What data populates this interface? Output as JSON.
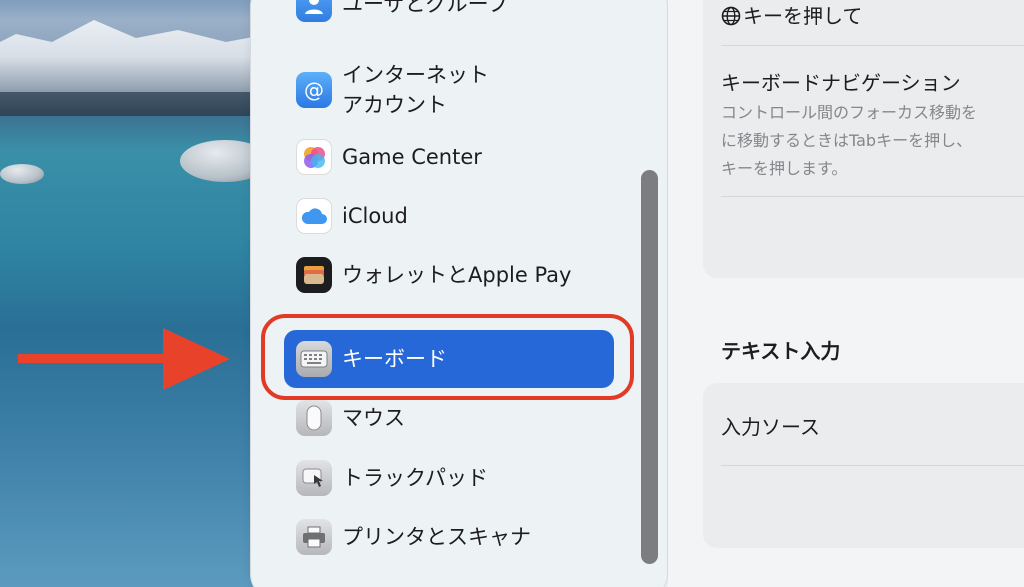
{
  "sidebar": {
    "items": [
      {
        "label": "ユーザとグループ",
        "icon": "users-icon"
      },
      {
        "label": "インターネット\nアカウント",
        "icon": "at-sign-icon"
      },
      {
        "label": "Game Center",
        "icon": "game-center-icon"
      },
      {
        "label": "iCloud",
        "icon": "icloud-icon"
      },
      {
        "label": "ウォレットとApple Pay",
        "icon": "wallet-icon"
      },
      {
        "label": "キーボード",
        "icon": "keyboard-icon",
        "selected": true
      },
      {
        "label": "マウス",
        "icon": "mouse-icon"
      },
      {
        "label": "トラックパッド",
        "icon": "trackpad-icon"
      },
      {
        "label": "プリンタとスキャナ",
        "icon": "printer-icon"
      }
    ]
  },
  "content": {
    "top_row": "キーを押して",
    "keyboard_navigation": {
      "title": "キーボードナビゲーション",
      "description": "コントロール間のフォーカス移動を\nに移動するときはTabキーを押し、\nキーを押します。"
    },
    "text_input_section": "テキスト入力",
    "input_source": "入力ソース"
  },
  "colors": {
    "selection": "#2768d8",
    "highlight_ring": "#e23b25",
    "arrow": "#e8432a"
  }
}
